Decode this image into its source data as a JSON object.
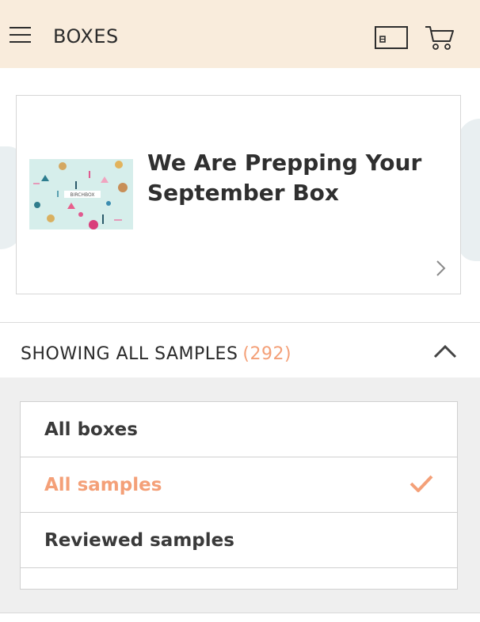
{
  "header": {
    "title": "BOXES",
    "icons": {
      "menu": "hamburger-menu-icon",
      "card": "gift-card-icon",
      "cart": "shopping-cart-icon"
    }
  },
  "promo": {
    "title": "We Are Prepping Your September Box",
    "image_label": "BIRCHBOX",
    "chevron": "chevron-right-icon"
  },
  "filter": {
    "label": "SHOWING ALL SAMPLES",
    "count": "(292)",
    "toggle_icon": "chevron-up-icon",
    "options": [
      {
        "label": "All boxes",
        "selected": false
      },
      {
        "label": "All samples",
        "selected": true
      },
      {
        "label": "Reviewed samples",
        "selected": false
      }
    ]
  },
  "colors": {
    "header_bg": "#f9ecdc",
    "accent": "#f4a078",
    "panel_bg": "#efefef"
  }
}
